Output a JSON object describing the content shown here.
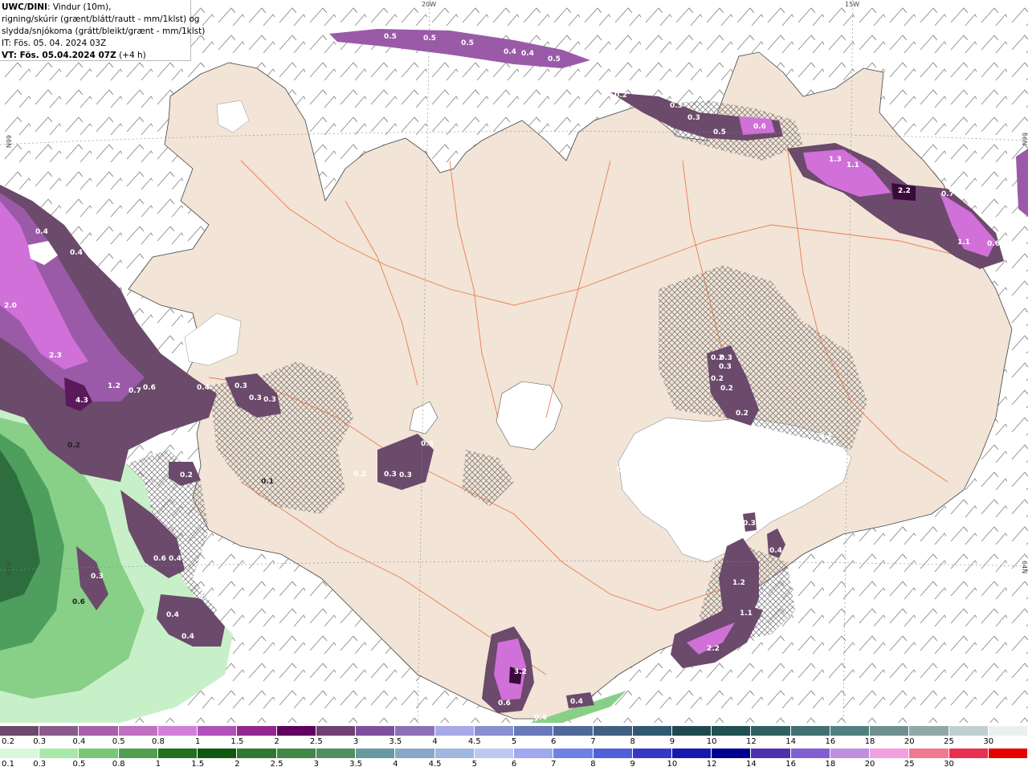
{
  "header": {
    "model": "UWC/DINI",
    "line1": ": Vindur (10m),",
    "line2": "rigning/skúrir (grænt/blátt/rautt - mm/1klst) og",
    "line3": "slydda/snjókoma (grátt/bleikt/grænt - mm/1klst)",
    "it": "IT: Fös. 05. 04. 2024 03Z",
    "vt": "VT: Fös. 05.04.2024 07Z",
    "lead": " (+4 h)"
  },
  "coords": {
    "lon_20w": "20W",
    "lon_15w": "15W",
    "lat_66n_left": "66N",
    "lat_66n_right": "66N",
    "lat_64n_left": "64N",
    "lat_64n_right": "64N"
  },
  "precip_labels": [
    "0.5",
    "0.5",
    "0.5",
    "0.4",
    "0.4",
    "0.5",
    "0.2",
    "0.3",
    "0.3",
    "0.5",
    "0.6",
    "1.3",
    "1.1",
    "2.2",
    "0.7",
    "1.1",
    "0.6",
    "0.4",
    "0.3",
    "0.4",
    "2.0",
    "2.3",
    "4.3",
    "1.2",
    "0.7",
    "0.6",
    "0.4",
    "0.3",
    "0.3",
    "0.3",
    "0.2",
    "0.2",
    "0.1",
    "0.2",
    "0.2",
    "0.3",
    "0.2",
    "0.3",
    "0.2",
    "0.2",
    "0.2",
    "0.3",
    "0.3",
    "0.3",
    "0.4",
    "0.6",
    "0.3",
    "0.6",
    "0.4",
    "0.4",
    "0.4",
    "3.2",
    "0.6",
    "0.4",
    "0.4",
    "0.3",
    "0.4",
    "1.2",
    "1.1",
    "2.2",
    "0.2"
  ],
  "legend": {
    "snow_ticks": [
      "0.2",
      "0.3",
      "0.4",
      "0.5",
      "0.8",
      "1",
      "1.5",
      "2",
      "2.5",
      "3",
      "3.5",
      "4",
      "4.5",
      "5",
      "6",
      "7",
      "8",
      "9",
      "10",
      "12",
      "14",
      "16",
      "18",
      "20",
      "25",
      "30"
    ],
    "snow_colors": [
      "#6b4a6b",
      "#8a5a8a",
      "#a860a8",
      "#c070c0",
      "#d080d8",
      "#b050b8",
      "#902890",
      "#600060",
      "#704070",
      "#7c509c",
      "#8a70b8",
      "#a8a8e8",
      "#8890d0",
      "#6878b8",
      "#506898",
      "#406080",
      "#305870",
      "#204850",
      "#205050",
      "#306060",
      "#407070",
      "#508080",
      "#709090",
      "#90a8a8",
      "#c0d0d0",
      "#e8f0f0"
    ],
    "rain_ticks": [
      "0.1",
      "0.3",
      "0.5",
      "0.8",
      "1",
      "1.5",
      "2",
      "2.5",
      "3",
      "3.5",
      "4",
      "4.5",
      "5",
      "6",
      "7",
      "8",
      "9",
      "10",
      "12",
      "14",
      "16",
      "18",
      "20",
      "25",
      "30"
    ],
    "rain_colors": [
      "#d8f8d8",
      "#a8e8a8",
      "#78c878",
      "#50a050",
      "#207020",
      "#105810",
      "#307830",
      "#408848",
      "#509060",
      "#6898a0",
      "#88a8c8",
      "#a0b8e0",
      "#c0c8f0",
      "#a0a8f0",
      "#7080e8",
      "#5060d8",
      "#3838c8",
      "#1818b0",
      "#000090",
      "#5030b0",
      "#8060d0",
      "#c090e0",
      "#f0a0e0",
      "#f07890",
      "#e83050",
      "#e80000"
    ]
  }
}
